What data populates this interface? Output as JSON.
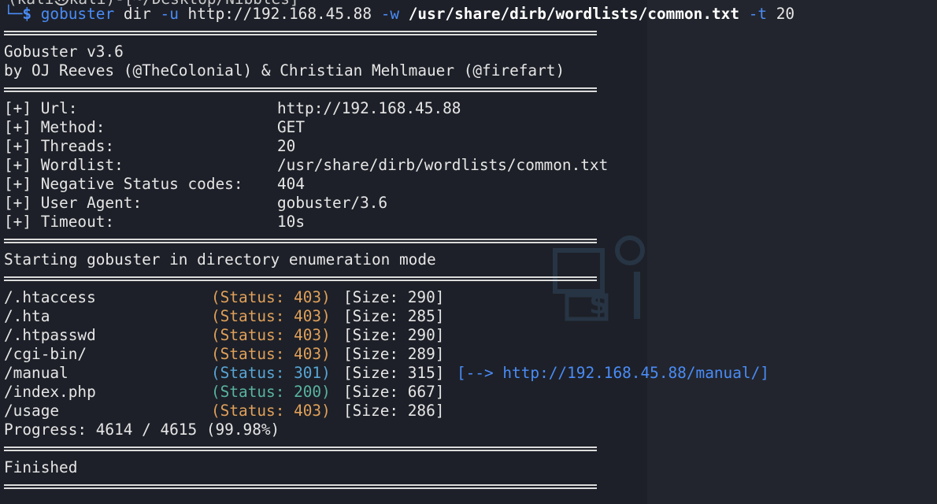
{
  "prompt": {
    "ghost_text": "(kali㉿kali)-[~/Desktop/Nibbles]",
    "tree_glyph": "└─",
    "symbol": "$",
    "cmd": "gobuster",
    "args": [
      {
        "text": " dir",
        "color": "default",
        "bold": false
      },
      {
        "text": " -u",
        "color": "blue",
        "bold": false
      },
      {
        "text": " http://192.168.45.88",
        "color": "default",
        "bold": false
      },
      {
        "text": " -w",
        "color": "blue",
        "bold": false
      },
      {
        "text": " /usr/share/dirb/wordlists/common.txt",
        "color": "white",
        "bold": true
      },
      {
        "text": " -t",
        "color": "blue",
        "bold": false
      },
      {
        "text": " 20",
        "color": "default",
        "bold": false
      }
    ]
  },
  "banner": {
    "title": "Gobuster v3.6",
    "authors": "by OJ Reeves (@TheColonial) & Christian Mehlmauer (@firefart)"
  },
  "config": [
    {
      "key": "[+] Url:",
      "value": "http://192.168.45.88"
    },
    {
      "key": "[+] Method:",
      "value": "GET"
    },
    {
      "key": "[+] Threads:",
      "value": "20"
    },
    {
      "key": "[+] Wordlist:",
      "value": "/usr/share/dirb/wordlists/common.txt"
    },
    {
      "key": "[+] Negative Status codes:",
      "value": "404"
    },
    {
      "key": "[+] User Agent:",
      "value": "gobuster/3.6"
    },
    {
      "key": "[+] Timeout:",
      "value": "10s"
    }
  ],
  "mode_message": "Starting gobuster in directory enumeration mode",
  "results": [
    {
      "path": "/.htaccess",
      "status": "(Status: 403)",
      "code": "403",
      "size": "[Size: 290]",
      "redirect": ""
    },
    {
      "path": "/.hta",
      "status": "(Status: 403)",
      "code": "403",
      "size": "[Size: 285]",
      "redirect": ""
    },
    {
      "path": "/.htpasswd",
      "status": "(Status: 403)",
      "code": "403",
      "size": "[Size: 290]",
      "redirect": ""
    },
    {
      "path": "/cgi-bin/",
      "status": "(Status: 403)",
      "code": "403",
      "size": "[Size: 289]",
      "redirect": ""
    },
    {
      "path": "/manual",
      "status": "(Status: 301)",
      "code": "301",
      "size": "[Size: 315]",
      "redirect": "[--> http://192.168.45.88/manual/]"
    },
    {
      "path": "/index.php",
      "status": "(Status: 200)",
      "code": "200",
      "size": "[Size: 667]",
      "redirect": ""
    },
    {
      "path": "/usage",
      "status": "(Status: 403)",
      "code": "403",
      "size": "[Size: 286]",
      "redirect": ""
    }
  ],
  "progress": "Progress: 4614 / 4615 (99.98%)",
  "finished": "Finished",
  "colors": {
    "background": "#1d2028",
    "status_403": "#e0a05a",
    "status_301": "#58a6d6",
    "status_200": "#59b3a0",
    "option_flag": "#4a8cf7"
  }
}
